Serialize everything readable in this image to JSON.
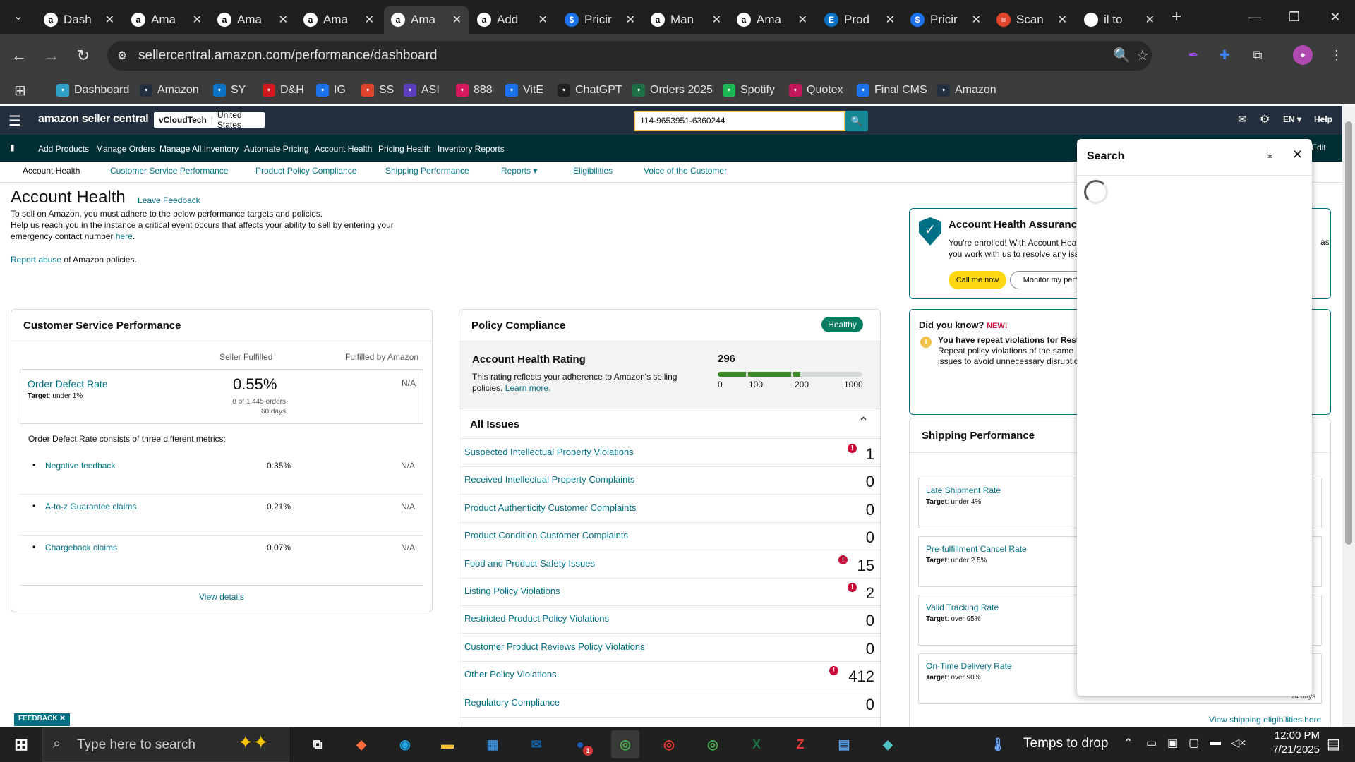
{
  "browser": {
    "tabs": [
      {
        "label": "Dash",
        "icon": "amazon-icon",
        "color": "#2fa0c8"
      },
      {
        "label": "Ama",
        "icon": "amazon-icon",
        "color": "#ffffff"
      },
      {
        "label": "Ama",
        "icon": "amazon-icon",
        "color": "#ffffff"
      },
      {
        "label": "Ama",
        "icon": "amazon-icon",
        "color": "#ffffff"
      },
      {
        "label": "Ama",
        "icon": "amazon-icon",
        "color": "#ffffff"
      },
      {
        "label": "Add",
        "icon": "amazon-icon",
        "color": "#ffffff"
      },
      {
        "label": "Pricir",
        "icon": "dollar-icon",
        "color": "#1a73e8"
      },
      {
        "label": "Man",
        "icon": "amazon-icon",
        "color": "#ffffff"
      },
      {
        "label": "Ama",
        "icon": "amazon-icon",
        "color": "#ffffff"
      },
      {
        "label": "Prod",
        "icon": "ec-icon",
        "color": "#0b72c6"
      },
      {
        "label": "Pricir",
        "icon": "dollar-icon",
        "color": "#1a73e8"
      },
      {
        "label": "Scan",
        "icon": "stack-icon",
        "color": "#e0452c"
      },
      {
        "label": "il to",
        "icon": "google-icon",
        "color": "#ffffff"
      }
    ],
    "active_tab": 4,
    "url": "sellercentral.amazon.com/performance/dashboard",
    "bookmarks": [
      {
        "label": "Dashboard",
        "color": "#2fa0c8"
      },
      {
        "label": "Amazon",
        "color": "#232f3e"
      },
      {
        "label": "SY",
        "color": "#0b72c6"
      },
      {
        "label": "D&H",
        "color": "#d0191e"
      },
      {
        "label": "IG",
        "color": "#1a73e8"
      },
      {
        "label": "SS",
        "color": "#e0452c"
      },
      {
        "label": "ASI",
        "color": "#5b3fbf"
      },
      {
        "label": "888",
        "color": "#d81b60"
      },
      {
        "label": "VitE",
        "color": "#1a73e8"
      },
      {
        "label": "ChatGPT",
        "color": "#202020"
      },
      {
        "label": "Orders 2025",
        "color": "#1d7044"
      },
      {
        "label": "Spotify",
        "color": "#1db954"
      },
      {
        "label": "Quotex",
        "color": "#c2185b"
      },
      {
        "label": "Final CMS",
        "color": "#1a73e8"
      },
      {
        "label": "Amazon",
        "color": "#232f3e"
      }
    ]
  },
  "header": {
    "logo": "amazon seller central",
    "store": "vCloudTech",
    "region": "United States",
    "search_value": "114-9653951-6360244",
    "lang": "EN",
    "help": "Help"
  },
  "nav": [
    "Add Products",
    "Manage Orders",
    "Manage All Inventory",
    "Automate Pricing",
    "Account Health",
    "Pricing Health",
    "Inventory Reports"
  ],
  "nav_edit": "Edit",
  "subnav": [
    "Account Health",
    "Customer Service Performance",
    "Product Policy Compliance",
    "Shipping Performance",
    "Reports",
    "Eligibilities",
    "Voice of the Customer"
  ],
  "intro": {
    "title": "Account Health",
    "leave_feedback": "Leave Feedback",
    "line1": "To sell on Amazon, you must adhere to the below performance targets and policies.",
    "line2": "Help us reach you in the instance a critical event occurs that affects your ability to sell by entering your",
    "line3": "emergency contact number",
    "here": "here",
    "dot": ".",
    "report_abuse": "Report abuse",
    "report_rest": "of Amazon policies."
  },
  "csp": {
    "title": "Customer Service Performance",
    "col1": "Seller Fulfilled",
    "col2": "Fulfilled by Amazon",
    "odr_label": "Order Defect Rate",
    "target_bold": "Target",
    "odr_target": ": under 1%",
    "odr_value": "0.55%",
    "odr_orders": "8 of 1,445 orders",
    "odr_days": "60 days",
    "odr_fba": "N/A",
    "consists": "Order Defect Rate consists of three different metrics:",
    "metrics": [
      {
        "label": "Negative feedback",
        "value": "0.35%",
        "fba": "N/A"
      },
      {
        "label": "A-to-z Guarantee claims",
        "value": "0.21%",
        "fba": "N/A"
      },
      {
        "label": "Chargeback claims",
        "value": "0.07%",
        "fba": "N/A"
      }
    ],
    "view_details": "View details"
  },
  "policy": {
    "title": "Policy Compliance",
    "badge": "Healthy",
    "ahr_title": "Account Health Rating",
    "ahr_value": "296",
    "ahr_desc1": "This rating reflects your adherence to Amazon's selling",
    "ahr_desc2": "policies.",
    "learn_more": "Learn more.",
    "scale": [
      "0",
      "100",
      "200",
      "1000"
    ],
    "all_issues": "All Issues",
    "issues": [
      {
        "label": "Suspected Intellectual Property Violations",
        "count": "1",
        "alert": true
      },
      {
        "label": "Received Intellectual Property Complaints",
        "count": "0",
        "alert": false
      },
      {
        "label": "Product Authenticity Customer Complaints",
        "count": "0",
        "alert": false
      },
      {
        "label": "Product Condition Customer Complaints",
        "count": "0",
        "alert": false
      },
      {
        "label": "Food and Product Safety Issues",
        "count": "15",
        "alert": true
      },
      {
        "label": "Listing Policy Violations",
        "count": "2",
        "alert": true
      },
      {
        "label": "Restricted Product Policy Violations",
        "count": "0",
        "alert": false
      },
      {
        "label": "Customer Product Reviews Policy Violations",
        "count": "0",
        "alert": false
      },
      {
        "label": "Other Policy Violations",
        "count": "412",
        "alert": true
      },
      {
        "label": "Regulatory Compliance",
        "count": "0",
        "alert": false
      }
    ]
  },
  "aha": {
    "title": "Account Health Assurance",
    "line1": "You're enrolled! With Account Heal",
    "line2": "you work with us to resolve any iss",
    "as": "as",
    "call": "Call me now",
    "monitor": "Monitor my perfo"
  },
  "dyk": {
    "title": "Did you know?",
    "new": "NEW!",
    "bold": "You have repeat violations for Restr",
    "line2": "Repeat policy violations of the same",
    "line3": "issues to avoid unnecessary disruptio"
  },
  "ship": {
    "title": "Shipping Performance",
    "target_bold": "Target",
    "metrics": [
      {
        "label": "Late Shipment Rate",
        "target": ": under 4%"
      },
      {
        "label": "Pre-fulfillment Cancel Rate",
        "target": ": under 2.5%"
      },
      {
        "label": "Valid Tracking Rate",
        "target": ": over 95%"
      },
      {
        "label": "On-Time Delivery Rate",
        "target": ": over 90%"
      }
    ],
    "days": "14 days",
    "view_elig": "View shipping eligibilities here"
  },
  "search_panel": {
    "title": "Search"
  },
  "feedback_tab": "FEEDBACK",
  "taskbar": {
    "search_placeholder": "Type here to search",
    "weather": "Temps to drop",
    "time": "12:00 PM",
    "date": "7/21/2025",
    "mail_badge": "1"
  }
}
